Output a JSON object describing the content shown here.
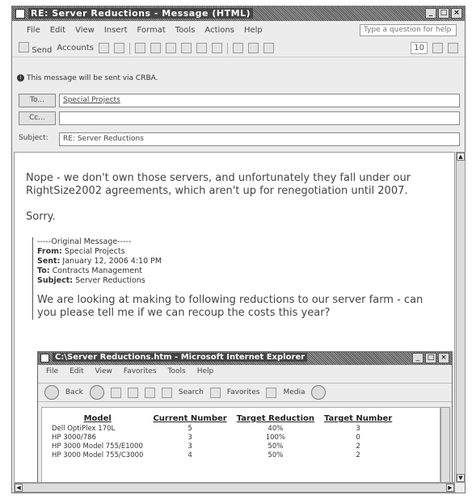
{
  "window": {
    "title": "RE: Server Reductions - Message (HTML)"
  },
  "menu": [
    "File",
    "Edit",
    "View",
    "Insert",
    "Format",
    "Tools",
    "Actions",
    "Help"
  ],
  "ask_box": "Type a question for help",
  "toolbar": {
    "send_label": "Send",
    "accounts_label": "Accounts",
    "font_size": "10"
  },
  "info_bar": "This message will be sent via CRBA.",
  "to": {
    "button": "To...",
    "value": "Special Projects"
  },
  "cc": {
    "button": "Cc..."
  },
  "subject": {
    "label": "Subject:",
    "value": "RE: Server Reductions"
  },
  "body": {
    "reply_line1": "Nope - we don't own those servers, and unfortunately they fall under our",
    "reply_line2": "RightSize2002 agreements, which aren't up for renegotiation until 2007.",
    "sorry": "Sorry.",
    "original_header": "-----Original Message-----",
    "from_label": "From:",
    "from_value": "Special Projects",
    "sent_label": "Sent:",
    "sent_value": "January 12, 2006 4:10 PM",
    "to_label": "To:",
    "to_value": "Contracts Management",
    "subject_label": "Subject:",
    "subject_value": "Server Reductions",
    "request_line1": "We are looking at making to following reductions to our server farm - can",
    "request_line2": "you please tell me if we can recoup the costs this year?"
  },
  "embedded_window": {
    "title": "C:\\Server Reductions.htm - Microsoft Internet Explorer",
    "menu": [
      "File",
      "Edit",
      "View",
      "Favorites",
      "Tools",
      "Help"
    ],
    "toolbar": {
      "back": "Back",
      "search": "Search",
      "favorites": "Favorites",
      "media": "Media"
    },
    "table": {
      "headers": [
        "Model",
        "Current Number",
        "Target Reduction",
        "Target Number"
      ],
      "rows": [
        [
          "Dell OptiPlex 170L",
          "5",
          "40%",
          "3"
        ],
        [
          "HP 3000/786",
          "3",
          "100%",
          "0"
        ],
        [
          "HP 3000 Model 755/E1000",
          "3",
          "50%",
          "2"
        ],
        [
          "HP 3000 Model 755/C3000",
          "4",
          "50%",
          "2"
        ]
      ]
    }
  }
}
